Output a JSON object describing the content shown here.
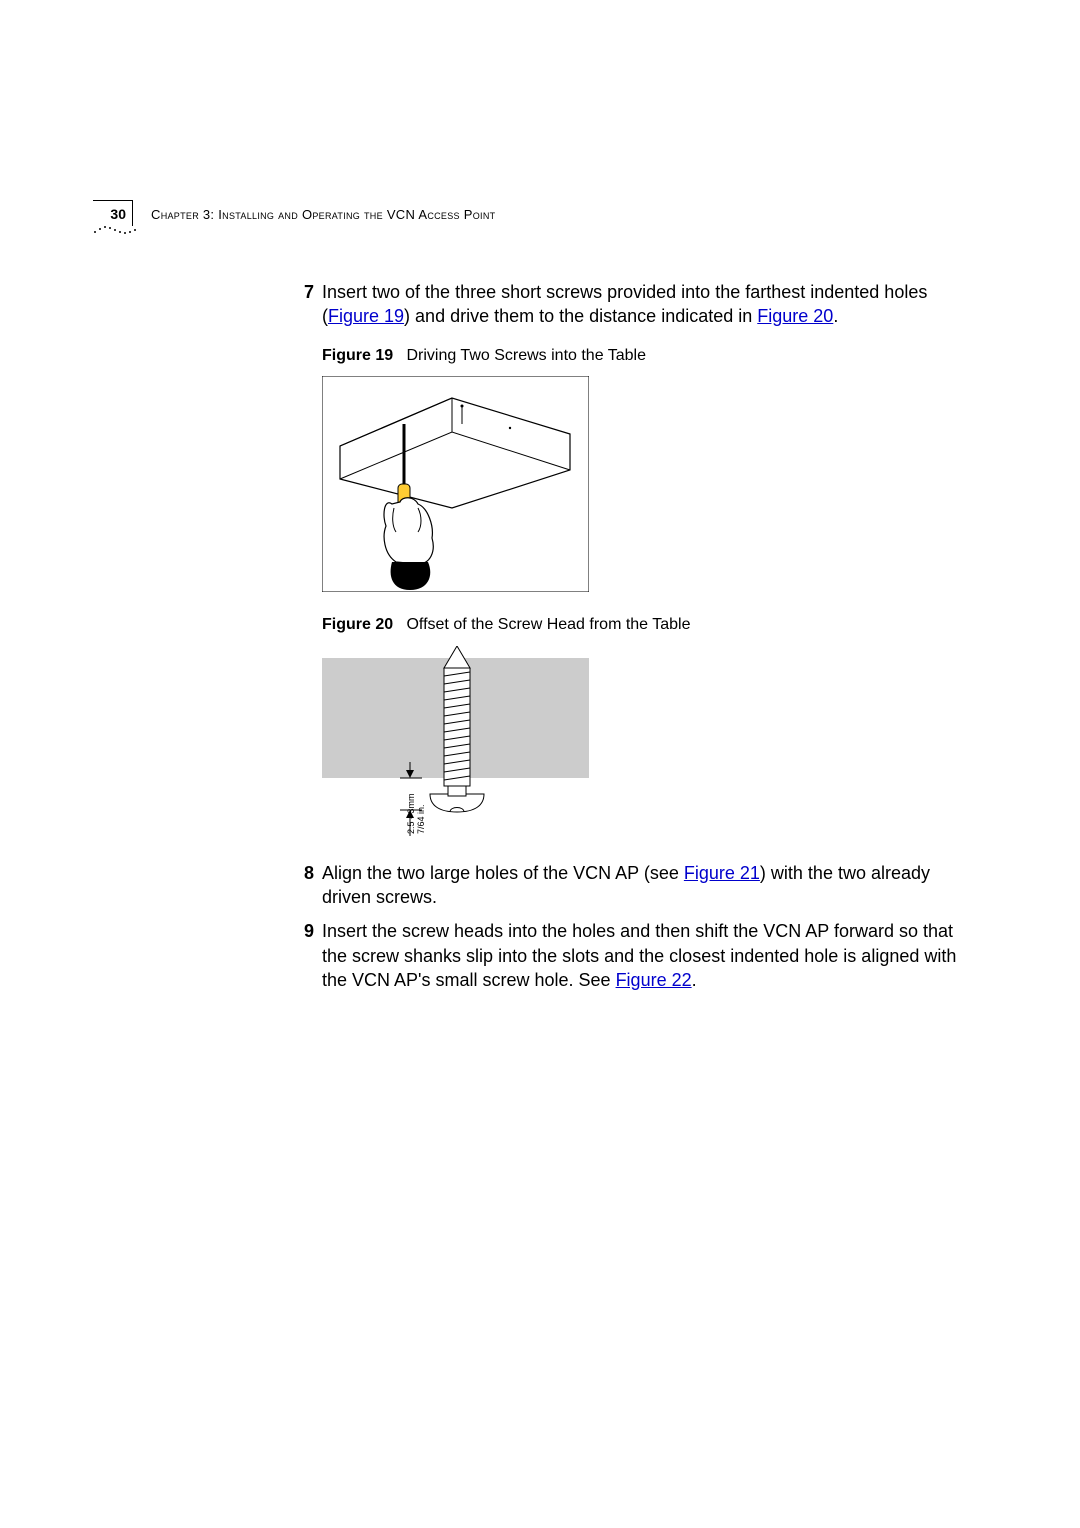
{
  "header": {
    "page_number": "30",
    "chapter_label": "Chapter 3: Installing and Operating the VCN Access Point"
  },
  "steps": {
    "s7": {
      "num": "7",
      "text_a": "Insert two of the three short screws provided into the farthest indented holes (",
      "link19": "Figure 19",
      "text_b": ") and drive them to the distance indicated in ",
      "link20": "Figure 20",
      "text_c": "."
    },
    "s8": {
      "num": "8",
      "text_a": "Align the two large holes of the VCN AP (see ",
      "link21": "Figure 21",
      "text_b": ") with the two already driven screws."
    },
    "s9": {
      "num": "9",
      "text_a": "Insert the screw heads into the holes and then shift the VCN AP forward so that the screw shanks slip into the slots and the closest indented hole is aligned with the VCN AP's small screw hole. See ",
      "link22": "Figure 22",
      "text_b": "."
    }
  },
  "figures": {
    "fig19": {
      "label": "Figure 19",
      "caption": "Driving Two Screws into the Table"
    },
    "fig20": {
      "label": "Figure 20",
      "caption": "Offset of the Screw Head from the Table",
      "dim_label_a": "7/64 in.",
      "dim_label_b": "2.5 - 3mm"
    }
  },
  "colors": {
    "link": "#0000cc",
    "text": "#000000"
  }
}
